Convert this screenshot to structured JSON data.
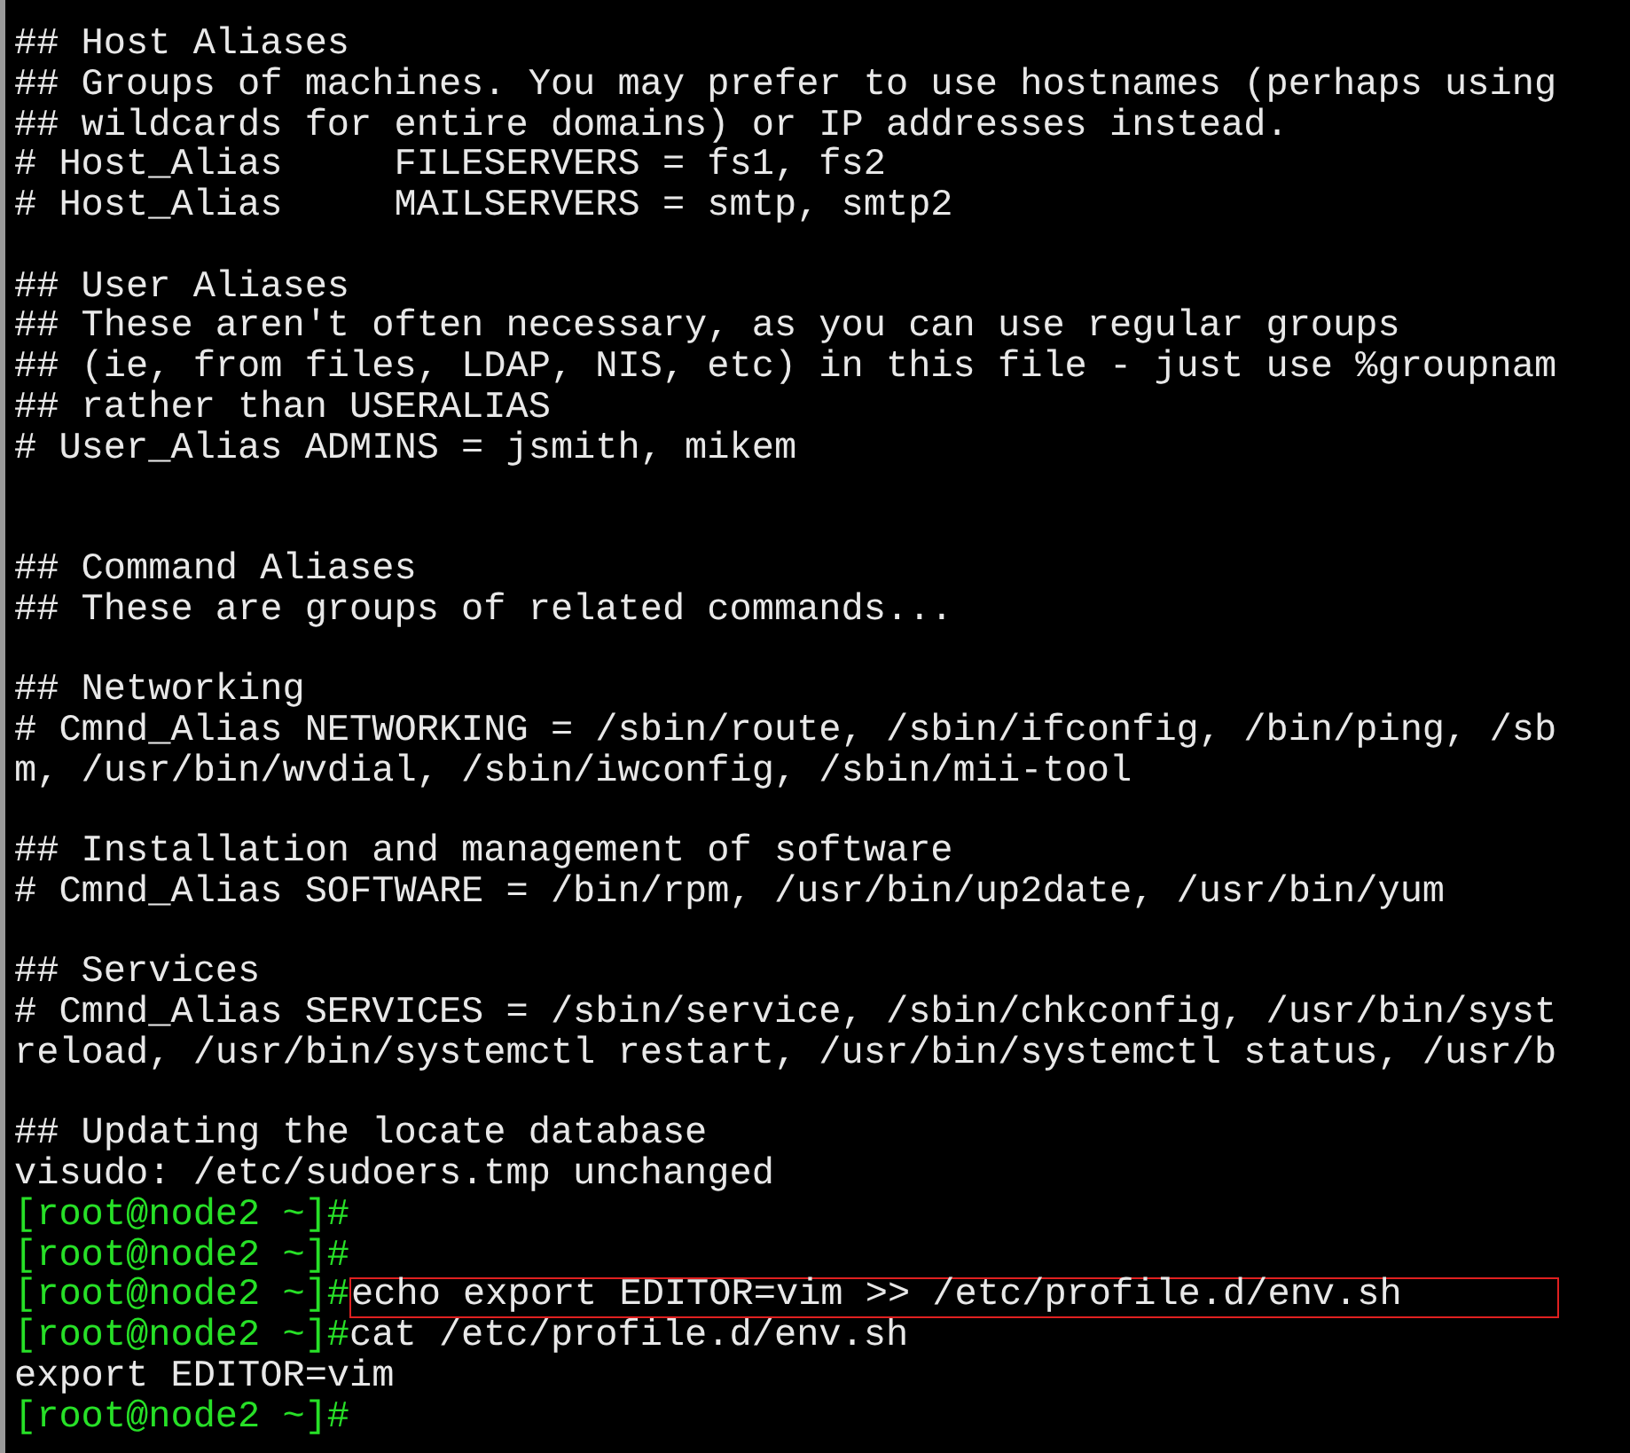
{
  "terminal": {
    "lines": [
      {
        "kind": "text",
        "text": "## Host Aliases"
      },
      {
        "kind": "text",
        "text": "## Groups of machines. You may prefer to use hostnames (perhaps using"
      },
      {
        "kind": "text",
        "text": "## wildcards for entire domains) or IP addresses instead."
      },
      {
        "kind": "text",
        "text": "# Host_Alias     FILESERVERS = fs1, fs2"
      },
      {
        "kind": "text",
        "text": "# Host_Alias     MAILSERVERS = smtp, smtp2"
      },
      {
        "kind": "blank"
      },
      {
        "kind": "text",
        "text": "## User Aliases"
      },
      {
        "kind": "text",
        "text": "## These aren't often necessary, as you can use regular groups"
      },
      {
        "kind": "text",
        "text": "## (ie, from files, LDAP, NIS, etc) in this file - just use %groupnam"
      },
      {
        "kind": "text",
        "text": "## rather than USERALIAS"
      },
      {
        "kind": "text",
        "text": "# User_Alias ADMINS = jsmith, mikem"
      },
      {
        "kind": "blank"
      },
      {
        "kind": "blank"
      },
      {
        "kind": "text",
        "text": "## Command Aliases"
      },
      {
        "kind": "text",
        "text": "## These are groups of related commands..."
      },
      {
        "kind": "blank"
      },
      {
        "kind": "text",
        "text": "## Networking"
      },
      {
        "kind": "text",
        "text": "# Cmnd_Alias NETWORKING = /sbin/route, /sbin/ifconfig, /bin/ping, /sb"
      },
      {
        "kind": "text",
        "text": "m, /usr/bin/wvdial, /sbin/iwconfig, /sbin/mii-tool"
      },
      {
        "kind": "blank"
      },
      {
        "kind": "text",
        "text": "## Installation and management of software"
      },
      {
        "kind": "text",
        "text": "# Cmnd_Alias SOFTWARE = /bin/rpm, /usr/bin/up2date, /usr/bin/yum"
      },
      {
        "kind": "blank"
      },
      {
        "kind": "text",
        "text": "## Services"
      },
      {
        "kind": "text",
        "text": "# Cmnd_Alias SERVICES = /sbin/service, /sbin/chkconfig, /usr/bin/syst"
      },
      {
        "kind": "text",
        "text": "reload, /usr/bin/systemctl restart, /usr/bin/systemctl status, /usr/b"
      },
      {
        "kind": "blank"
      },
      {
        "kind": "text",
        "text": "## Updating the locate database"
      },
      {
        "kind": "text",
        "text": "visudo: /etc/sudoers.tmp unchanged"
      },
      {
        "kind": "prompt",
        "prompt": "[root@node2 ~]#"
      },
      {
        "kind": "prompt",
        "prompt": "[root@node2 ~]#"
      },
      {
        "kind": "prompt",
        "prompt": "[root@node2 ~]#",
        "command": "echo export EDITOR=vim >> /etc/profile.d/env.sh",
        "highlighted": true
      },
      {
        "kind": "prompt",
        "prompt": "[root@node2 ~]#",
        "command": "cat /etc/profile.d/env.sh",
        "highlighted": false
      },
      {
        "kind": "text",
        "text": "export EDITOR=vim"
      },
      {
        "kind": "prompt",
        "prompt": "[root@node2 ~]#"
      }
    ]
  }
}
